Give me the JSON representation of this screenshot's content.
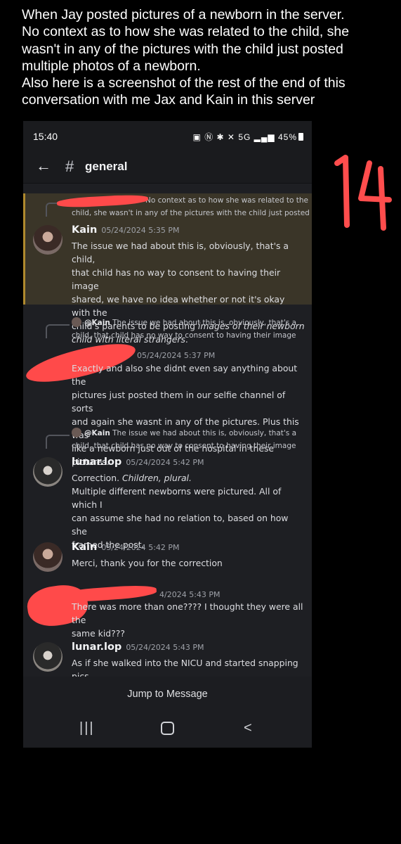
{
  "caption": {
    "lines": [
      "When Jay posted pictures of a newborn in the server.",
      "No context as to how she was related to the child, she",
      "wasn't in any of the pictures with the child just posted",
      "multiple photos of a newborn.",
      "Also here is a screenshot of the rest of the end of this",
      "conversation with me Jax and Kain in this server"
    ]
  },
  "annotation_number": "14",
  "status_bar": {
    "time": "15:40",
    "network": "5G",
    "battery": "45%"
  },
  "header": {
    "channel": "general"
  },
  "messages": [
    {
      "reply_preview": [
        "No context as to how she was related to the",
        "child, she wasn't in any of the pictures with the child just posted"
      ],
      "author": "Kain",
      "timestamp": "05/24/2024 5:35 PM",
      "lines": [
        "The issue we had about this is, obviously, that's a child,",
        "that child has no way to consent to having their image",
        "shared, we have no idea whether or not it's okay with the",
        "child's parents to be posting ",
        "images of their newborn",
        "child with literal strangers",
        "."
      ]
    },
    {
      "reply_mention": "@Kain",
      "reply_preview": [
        "The issue we had about this is, obviously, that's a",
        "child, that child has no way to consent to having their image"
      ],
      "timestamp": "05/24/2024 5:37 PM",
      "lines": [
        "Exactly and also she didnt even say anything about the",
        "pictures just posted them in our selfie channel of sorts",
        "and again she wasnt in any of the pictures. Plus this was",
        "like a newborn just out of the hospital in these pictures."
      ]
    },
    {
      "reply_mention": "@Kain",
      "reply_preview": [
        "The issue we had about this is, obviously, that's a",
        "child, that child has no way to consent to having their image"
      ],
      "author": "lunar.lop",
      "timestamp": "05/24/2024 5:42 PM",
      "lines": [
        "Correction. ",
        "Children, plural.",
        "Multiple different newborns were pictured. All of which I",
        "can assume she had no relation to, based on how she",
        "framed the post."
      ]
    },
    {
      "author": "Kain",
      "timestamp": "05/24/2024 5:42 PM",
      "lines": [
        "Merci, thank you for the correction"
      ]
    },
    {
      "timestamp": "4/2024 5:43 PM",
      "lines": [
        "There was more than one???? I thought they were all the",
        "same kid???"
      ]
    },
    {
      "author": "lunar.lop",
      "timestamp": "05/24/2024 5:43 PM",
      "lines": [
        "As if she walked into the NICU and started snapping pics."
      ]
    }
  ],
  "jump_button": "Jump to Message",
  "colors": {
    "background": "#000000",
    "app_bg": "#1e1f23",
    "highlight_bg": "#3a3528",
    "redaction": "#ff4a4a"
  }
}
